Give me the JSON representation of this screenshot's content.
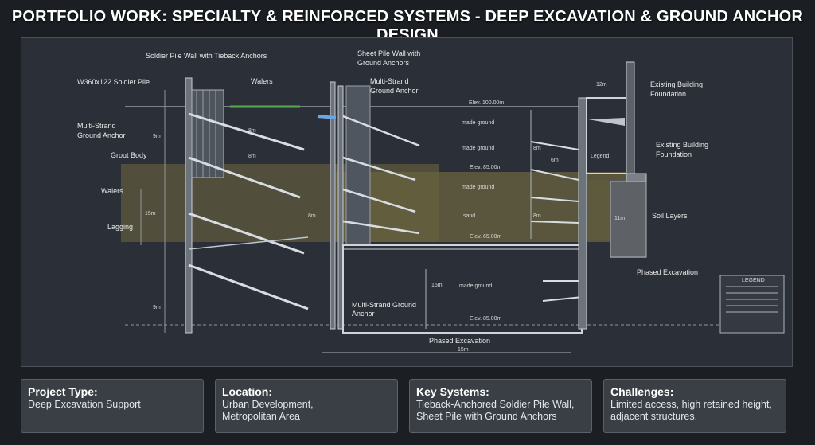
{
  "title": "PORTFOLIO WORK: SPECIALTY & REINFORCED SYSTEMS - DEEP EXCAVATION & GROUND ANCHOR DESIGN",
  "drawing": {
    "left_labels": {
      "soldier_pile_wall": "Soldier Pile Wall  with Tieback Anchors",
      "soldier_pile": "W360x122 Soldier Pile",
      "multi_strand_1": "Multi-Strand",
      "multi_strand_2": "Ground Anchor",
      "grout_body": "Grout Body",
      "walers_left": "Walers",
      "walers_top": "Walers",
      "lagging": "Lagging"
    },
    "center_labels": {
      "sheet_pile_1": "Sheet Pile Wall with",
      "sheet_pile_2": "Ground Anchors",
      "ms_anchor_1": "Multi-Strand",
      "ms_anchor_2": "Ground Anchor",
      "ms_anchor_low_1": "Multi-Strand Ground",
      "ms_anchor_low_2": "Anchor",
      "phased_excavation": "Phased Excavation"
    },
    "elevations": {
      "top": "Elev. 100.00m",
      "mid": "Elev. 85.00m",
      "lower": "Elev. 65.00m",
      "bottom": "Elev. 85.00m"
    },
    "layers": {
      "made_ground_1": "made ground",
      "made_ground_2": "made ground",
      "made_ground_3": "made ground",
      "sand": "sand",
      "made_ground_4": "made ground"
    },
    "dims": {
      "d8m_a": "8m",
      "d8m_b": "8m",
      "d8m_c": "8m",
      "d8m_d": "8m",
      "d8m_e": "8m",
      "d6m": "6m",
      "d15m": "15m",
      "d15m_b": "15m",
      "d9m": "9m",
      "d9m_b": "9m",
      "d12m": "12m",
      "d11m": "11m",
      "d15m_bottom": "15m"
    },
    "right_labels": {
      "existing_1a": "Existing Building",
      "existing_1b": "Foundation",
      "existing_2a": "Existing Building",
      "existing_2b": "Foundation",
      "soil_layers": "Soil Layers",
      "phased_excavation": "Phased Excavation",
      "legend_small": "Legend",
      "legend_title": "LEGEND"
    }
  },
  "cards": [
    {
      "title": "Project Type:",
      "body": "Deep Excavation Support"
    },
    {
      "title": "Location:",
      "body": "Urban Development,\nMetropolitan Area"
    },
    {
      "title": "Key Systems:",
      "body": "Tieback-Anchored Soldier Pile Wall,\nSheet Pile with Ground Anchors"
    },
    {
      "title": "Challenges:",
      "body": "Limited access, high retained height,\nadjacent structures."
    }
  ],
  "colors": {
    "background": "#1b1f24",
    "sheet": "#2b3038",
    "sand_band": "#6b6440",
    "card": "#3a3f46"
  }
}
